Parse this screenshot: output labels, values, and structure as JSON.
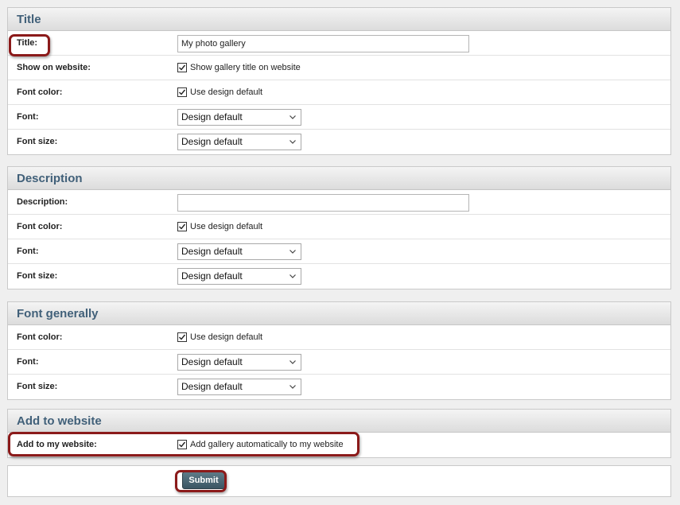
{
  "sections": {
    "title": {
      "heading": "Title",
      "title_label": "Title:",
      "title_value": "My photo gallery",
      "show_label": "Show on website:",
      "show_check_label": "Show gallery title on website",
      "font_color_label": "Font color:",
      "font_color_check_label": "Use design default",
      "font_label": "Font:",
      "font_value": "Design default",
      "font_size_label": "Font size:",
      "font_size_value": "Design default"
    },
    "description": {
      "heading": "Description",
      "description_label": "Description:",
      "description_value": "",
      "font_color_label": "Font color:",
      "font_color_check_label": "Use design default",
      "font_label": "Font:",
      "font_value": "Design default",
      "font_size_label": "Font size:",
      "font_size_value": "Design default"
    },
    "font_generally": {
      "heading": "Font generally",
      "font_color_label": "Font color:",
      "font_color_check_label": "Use design default",
      "font_label": "Font:",
      "font_value": "Design default",
      "font_size_label": "Font size:",
      "font_size_value": "Design default"
    },
    "add_to_website": {
      "heading": "Add to website",
      "add_label": "Add to my website:",
      "add_check_label": "Add gallery automatically to my website"
    }
  },
  "submit_label": "Submit",
  "colors": {
    "header_text": "#416079",
    "highlight": "#8b1a1a",
    "button": "#4a6673"
  },
  "icons": {
    "checkbox": "checked-checkbox-icon",
    "select": "chevron-down-icon"
  }
}
